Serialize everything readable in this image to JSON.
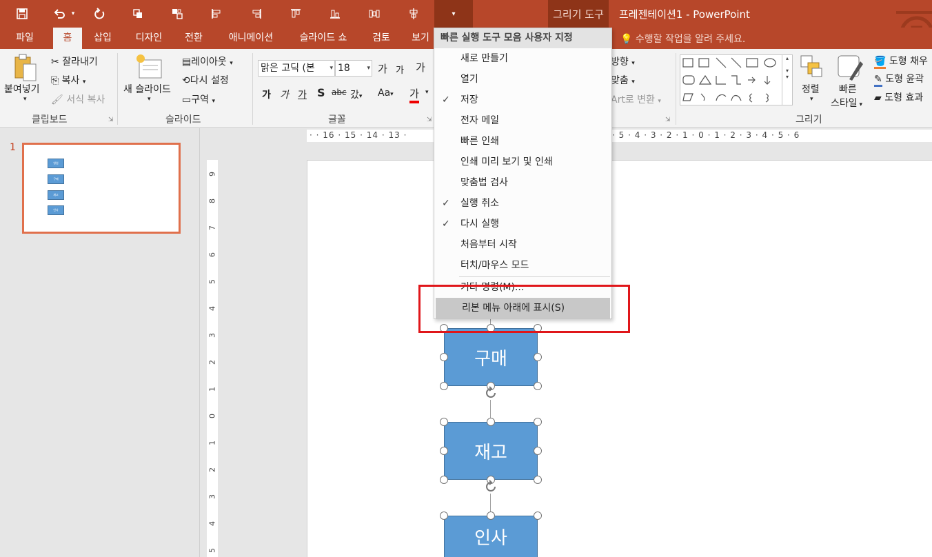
{
  "titlebar": {
    "context_tool": "그리기 도구",
    "document_title": "프레젠테이션1 - PowerPoint",
    "qat_icons": [
      "save-icon",
      "undo-icon",
      "redo-icon",
      "bring-forward-icon",
      "group-icon",
      "align-left-icon",
      "align-right-icon",
      "align-top-icon",
      "align-bottom-icon",
      "distribute-icon",
      "align-center-icon",
      "customize-qat-icon"
    ]
  },
  "tabs": [
    "파일",
    "홈",
    "삽입",
    "디자인",
    "전환",
    "애니메이션",
    "슬라이드 쇼",
    "검토",
    "보기"
  ],
  "active_tab": "홈",
  "tell_me": "수행할 작업을 알려 주세요.",
  "ribbon": {
    "clipboard": {
      "paste": "붙여넣기",
      "cut": "잘라내기",
      "copy": "복사",
      "format_painter": "서식 복사",
      "label": "클립보드"
    },
    "slides": {
      "new_slide": "새 슬라이드",
      "layout": "레이아웃",
      "reset": "다시 설정",
      "section": "구역",
      "label": "슬라이드"
    },
    "font": {
      "font_name": "맑은 고딕 (본",
      "font_size": "18",
      "grow": "가",
      "shrink": "가",
      "bold": "가",
      "italic": "가",
      "underline": "가",
      "shadow": "S",
      "strike": "abc",
      "spacing": "갔",
      "case": "Aa",
      "color": "가",
      "clear": "가",
      "label": "글꼴"
    },
    "paragraph_partial": {
      "direction": "방향",
      "align": "맞춤",
      "smartart": "Art로 변환"
    },
    "drawing": {
      "arrange": "정렬",
      "quick_styles_line1": "빠른",
      "quick_styles_line2": "스타일",
      "fill": "도형 채우",
      "outline": "도형 윤곽",
      "effects": "도형 효과",
      "label": "그리기"
    }
  },
  "thumbnail": {
    "number": "1",
    "boxes": [
      "영업",
      "구매",
      "재고",
      "인사"
    ]
  },
  "ruler": {
    "horizontal_left": [
      "16",
      "15",
      "14",
      "13"
    ],
    "horizontal_right": [
      "5",
      "4",
      "3",
      "2",
      "1",
      "0",
      "1",
      "2",
      "3",
      "4",
      "5",
      "6"
    ],
    "vertical": [
      "9",
      "8",
      "7",
      "6",
      "5",
      "4",
      "3",
      "2",
      "1",
      "0",
      "1",
      "2",
      "3",
      "4",
      "5"
    ]
  },
  "slide": {
    "nodes": [
      "구매",
      "재고",
      "인사"
    ]
  },
  "menu": {
    "header": "빠른 실행 도구 모음 사용자 지정",
    "items": [
      {
        "label": "새로 만들기",
        "checked": false
      },
      {
        "label": "열기",
        "checked": false
      },
      {
        "label": "저장",
        "checked": true
      },
      {
        "label": "전자 메일",
        "checked": false
      },
      {
        "label": "빠른 인쇄",
        "checked": false
      },
      {
        "label": "인쇄 미리 보기 및 인쇄",
        "checked": false
      },
      {
        "label": "맞춤법 검사",
        "checked": false
      },
      {
        "label": "실행 취소",
        "checked": true
      },
      {
        "label": "다시 실행",
        "checked": true
      },
      {
        "label": "처음부터 시작",
        "checked": false
      },
      {
        "label": "터치/마우스 모드",
        "checked": false
      }
    ],
    "more_commands": "기타 명령(M)...",
    "show_below": "리본 메뉴 아래에 표시(S)",
    "check_mark": "✓"
  },
  "colors": {
    "accent": "#b7472a",
    "shape_fill": "#5b9bd5",
    "highlight_border": "#e0161a"
  }
}
